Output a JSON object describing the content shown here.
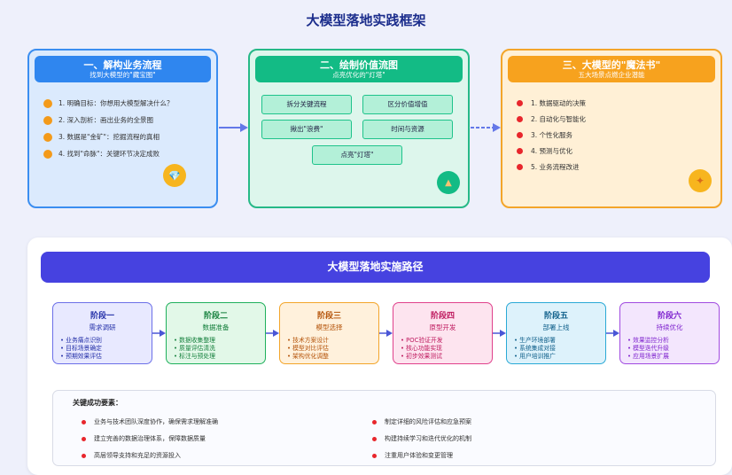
{
  "title": "大模型落地实践框架",
  "cards": [
    {
      "title": "一、解构业务流程",
      "subtitle": "找到大模型的\"藏宝图\"",
      "items": [
        "1. 明确目标：你想用大模型解决什么？",
        "2. 深入剖析：画出业务的全景图",
        "3. 数据是\"金矿\"：挖掘流程的真相",
        "4. 找到\"命脉\"：关键环节决定成败"
      ],
      "badge_icon": "gem-icon",
      "badge_glyph": "💎",
      "color": "#2f86ef"
    },
    {
      "title": "二、绘制价值流图",
      "subtitle": "点亮优化的\"灯塔\"",
      "boxes": [
        "拆分关键流程",
        "区分价值增值",
        "揪出\"浪费\"",
        "时间与资源",
        "点亮\"灯塔\""
      ],
      "badge_icon": "lighthouse-icon",
      "badge_glyph": "▲",
      "color": "#13bb85"
    },
    {
      "title": "三、大模型的\"魔法书\"",
      "subtitle": "五大场景点燃企业潜能",
      "items": [
        "1. 数据驱动的决策",
        "2. 自动化与智能化",
        "3. 个性化服务",
        "4. 预测与优化",
        "5. 业务流程改进"
      ],
      "badge_icon": "sparkle-icon",
      "badge_glyph": "✦",
      "color": "#f7a21e"
    }
  ],
  "path": {
    "title": "大模型落地实施路径",
    "stages": [
      {
        "title": "阶段一",
        "subtitle": "需求调研",
        "items": [
          "业务痛点识别",
          "目标场景确定",
          "预期效果评估"
        ],
        "color": "#6b6fe8",
        "bg": "#e8e9ff",
        "text": "#2430a8"
      },
      {
        "title": "阶段二",
        "subtitle": "数据准备",
        "items": [
          "数据收集整理",
          "质量评估清洗",
          "标注与预处理"
        ],
        "color": "#1fb05c",
        "bg": "#e2f8e8",
        "text": "#15803d"
      },
      {
        "title": "阶段三",
        "subtitle": "模型选择",
        "items": [
          "技术方案设计",
          "模型对比评估",
          "架构优化调整"
        ],
        "color": "#f3a52a",
        "bg": "#fff1dc",
        "text": "#b45309"
      },
      {
        "title": "阶段四",
        "subtitle": "原型开发",
        "items": [
          "POC验证开发",
          "核心功能实现",
          "初步效果测试"
        ],
        "color": "#e0418c",
        "bg": "#fde4ef",
        "text": "#be185d"
      },
      {
        "title": "阶段五",
        "subtitle": "部署上线",
        "items": [
          "生产环境部署",
          "系统集成对接",
          "用户培训推广"
        ],
        "color": "#2aa9d6",
        "bg": "#ddf2fb",
        "text": "#0e5f8a"
      },
      {
        "title": "阶段六",
        "subtitle": "持续优化",
        "items": [
          "效果监控分析",
          "模型迭代升级",
          "应用场景扩展"
        ],
        "color": "#a14be0",
        "bg": "#f3e6fd",
        "text": "#7e22ce"
      }
    ],
    "keys_title": "关键成功要素：",
    "keys": [
      "业务与技术团队深度协作，确保需求理解准确",
      "制定详细的风险评估和应急预案",
      "建立完善的数据治理体系，保障数据质量",
      "构建持续学习和迭代优化的机制",
      "高层领导支持和充足的资源投入",
      "注重用户体验和变更管理"
    ]
  }
}
